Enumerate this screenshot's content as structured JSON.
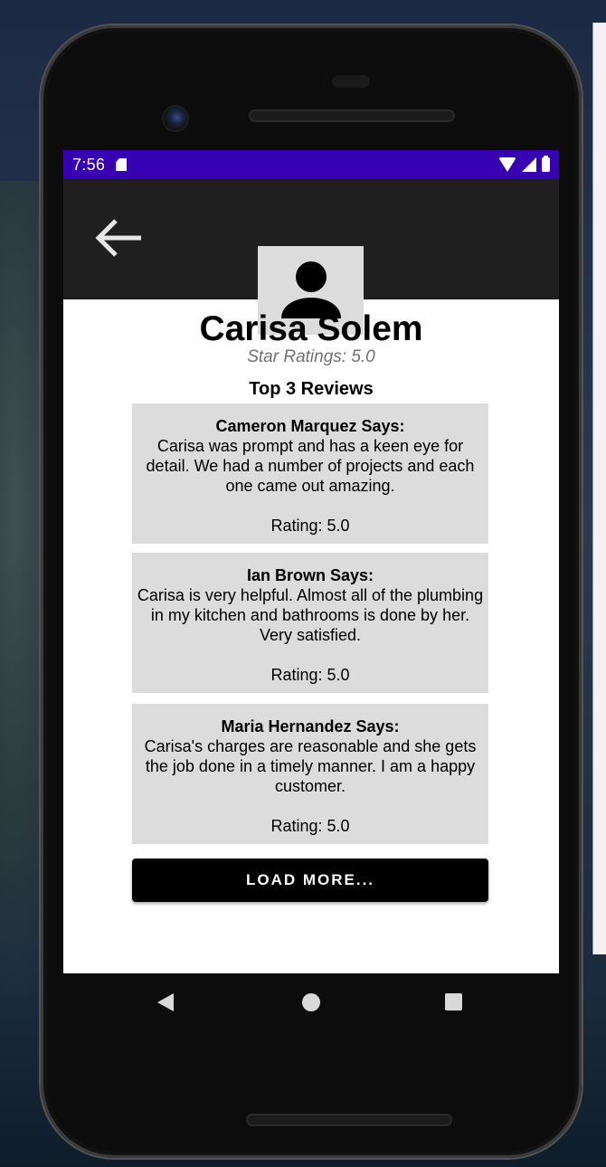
{
  "status_bar": {
    "time": "7:56"
  },
  "profile": {
    "name": "Carisa Solem",
    "star_ratings": "Star Ratings: 5.0"
  },
  "reviews_section": {
    "title": "Top 3 Reviews",
    "reviews": [
      {
        "author": "Cameron Marquez Says:",
        "text": "Carisa was prompt and has a keen eye for detail. We had a number of projects and each one came out amazing.",
        "rating": "Rating: 5.0"
      },
      {
        "author": "Ian Brown Says:",
        "text": "Carisa is very helpful. Almost all of the plumbing in my kitchen and bathrooms is done by her. Very satisfied.",
        "rating": "Rating: 5.0"
      },
      {
        "author": "Maria Hernandez Says:",
        "text": "Carisa's charges are reasonable and she gets the job done in a timely manner. I am a happy customer.",
        "rating": "Rating: 5.0"
      }
    ]
  },
  "load_more_label": "LOAD MORE...",
  "colors": {
    "status_bar": "#3700b3",
    "app_bar": "#1f1f1f",
    "card_background": "#dcdcdc",
    "button": "#000000"
  },
  "icons": {
    "back": "arrow-left-icon",
    "avatar": "person-icon",
    "nav_back": "triangle-back-icon",
    "nav_home": "circle-home-icon",
    "nav_recents": "square-recents-icon"
  }
}
